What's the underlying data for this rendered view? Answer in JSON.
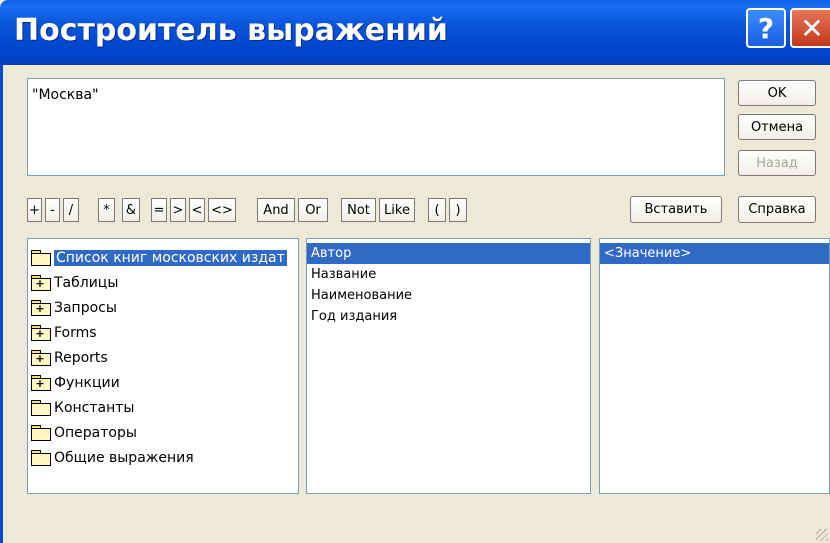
{
  "window": {
    "title": "Построитель выражений",
    "help_glyph": "?",
    "close_glyph": "✕"
  },
  "expression": {
    "value": "\"Москва\""
  },
  "buttons": {
    "ok": "OK",
    "cancel": "Отмена",
    "back": "Назад",
    "paste": "Вставить",
    "help": "Справка"
  },
  "operators": [
    "+",
    "-",
    "/",
    "*",
    "&",
    "=",
    ">",
    "<",
    "<>",
    "And",
    "Or",
    "Not",
    "Like",
    "(",
    ")"
  ],
  "tree": {
    "items": [
      {
        "label": "Список книг московских издат",
        "icon": "open-folder-icon",
        "selected": true
      },
      {
        "label": "Таблицы",
        "icon": "folder-plus-icon"
      },
      {
        "label": "Запросы",
        "icon": "folder-plus-icon"
      },
      {
        "label": "Forms",
        "icon": "folder-plus-icon"
      },
      {
        "label": "Reports",
        "icon": "folder-plus-icon"
      },
      {
        "label": "Функции",
        "icon": "folder-plus-icon"
      },
      {
        "label": "Константы",
        "icon": "folder-icon"
      },
      {
        "label": "Операторы",
        "icon": "folder-icon"
      },
      {
        "label": "Общие выражения",
        "icon": "folder-icon"
      }
    ]
  },
  "fields": {
    "items": [
      "Автор",
      "Название",
      "Наименование",
      "Год издания"
    ]
  },
  "values": {
    "items": [
      "<Значение>"
    ]
  },
  "colors": {
    "title_bar": "#0a52d8",
    "selection": "#316ac5",
    "face": "#ece9d8"
  }
}
